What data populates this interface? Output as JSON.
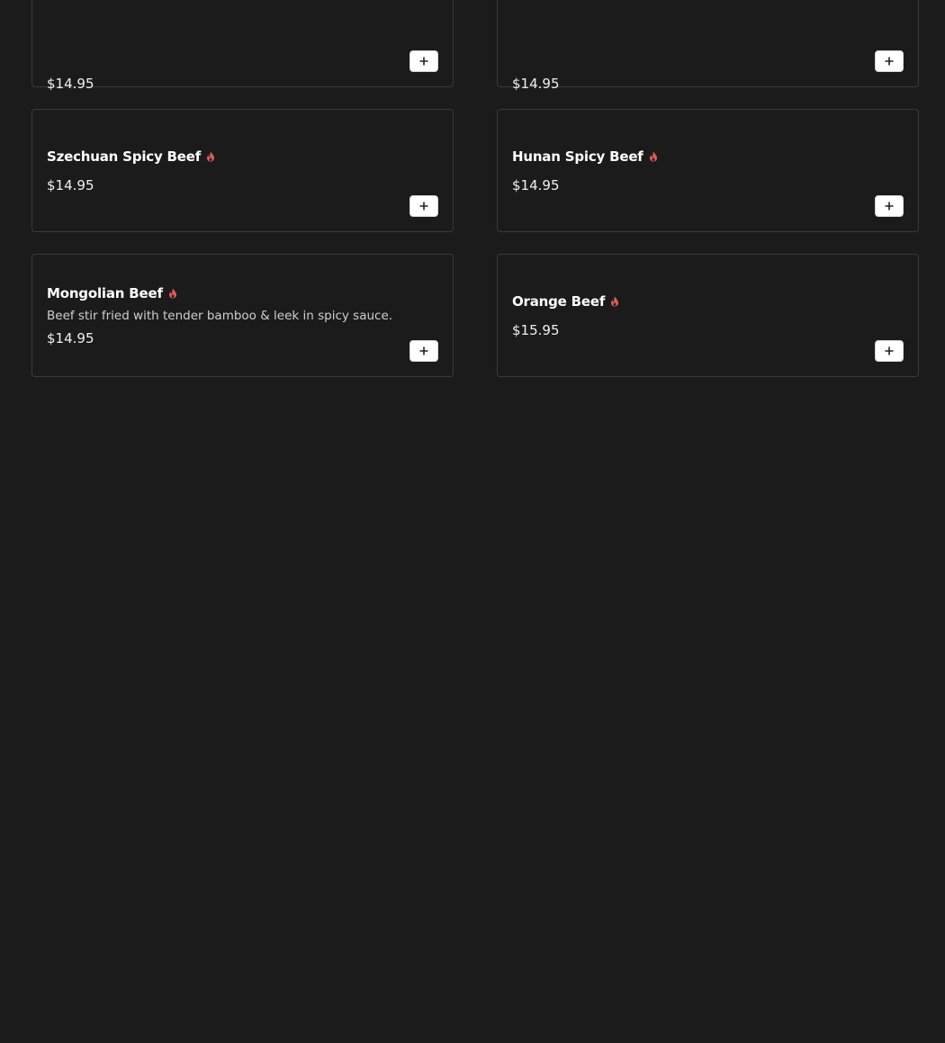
{
  "colors": {
    "background": "#1b1b1b",
    "card_border": "#3a3a3a",
    "spicy_icon": "#e05a55",
    "add_button_bg": "#ffffff"
  },
  "items": [
    {
      "name": "",
      "description": "",
      "price": "$14.95",
      "spicy": false
    },
    {
      "name": "",
      "description": "",
      "price": "$14.95",
      "spicy": false
    },
    {
      "name": "Szechuan Spicy Beef",
      "description": "",
      "price": "$14.95",
      "spicy": true
    },
    {
      "name": "Hunan Spicy Beef",
      "description": "",
      "price": "$14.95",
      "spicy": true
    },
    {
      "name": "Mongolian Beef",
      "description": "Beef stir fried with tender bamboo & leek in spicy sauce.",
      "price": "$14.95",
      "spicy": true
    },
    {
      "name": "Orange Beef",
      "description": "",
      "price": "$15.95",
      "spicy": true
    }
  ],
  "icons": {
    "spicy": "flame-icon",
    "add": "plus-icon"
  }
}
